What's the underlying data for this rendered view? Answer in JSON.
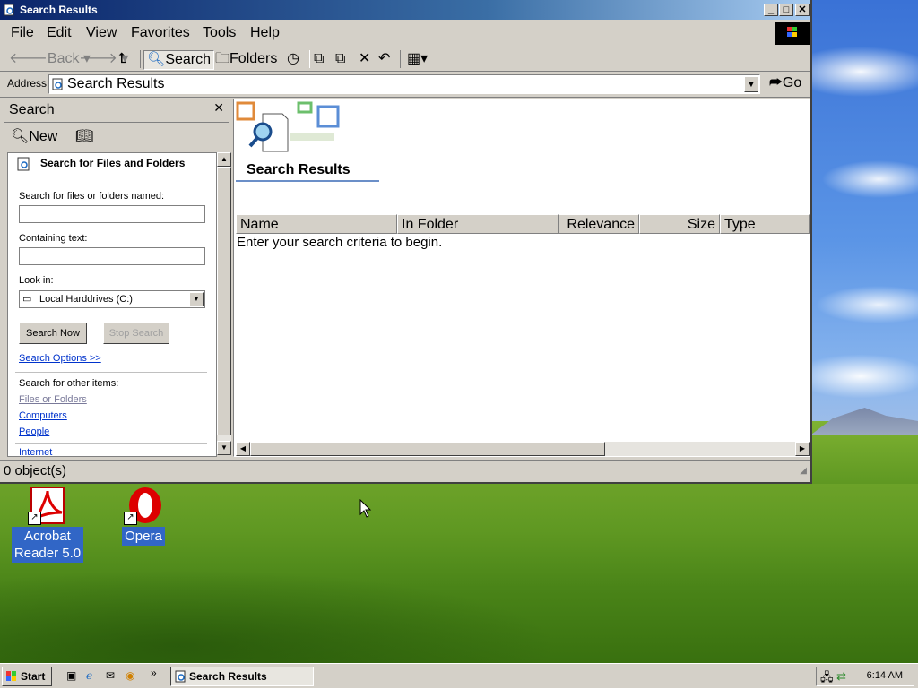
{
  "window": {
    "title": "Search Results",
    "menu": [
      "File",
      "Edit",
      "View",
      "Favorites",
      "Tools",
      "Help"
    ],
    "toolbar": {
      "back": "Back",
      "search": "Search",
      "folders": "Folders"
    },
    "address": {
      "label": "Address",
      "value": "Search Results",
      "go": "Go"
    },
    "status": "0 object(s)"
  },
  "search_pane": {
    "title": "Search",
    "new_label": "New",
    "heading": "Search for Files and Folders",
    "named_label": "Search for files or folders named:",
    "named_value": "",
    "containing_label": "Containing text:",
    "containing_value": "",
    "look_in_label": "Look in:",
    "look_in_value": "Local Harddrives (C:)",
    "search_now": "Search Now",
    "stop_search": "Stop Search",
    "options_link": "Search Options >>",
    "other_items_label": "Search for other items:",
    "other_items": [
      "Files or Folders",
      "Computers",
      "People",
      "Internet"
    ]
  },
  "results": {
    "title": "Search Results",
    "columns": [
      "Name",
      "In Folder",
      "Relevance",
      "Size",
      "Type"
    ],
    "empty_message": "Enter your search criteria to begin."
  },
  "desktop": {
    "icons": [
      {
        "label_line1": "Acrobat",
        "label_line2": "Reader 5.0"
      },
      {
        "label_line1": "Opera",
        "label_line2": ""
      }
    ]
  },
  "taskbar": {
    "start": "Start",
    "task": "Search Results",
    "clock": "6:14 AM"
  },
  "colors": {
    "titlebar_start": "#0a246a",
    "titlebar_end": "#a6caf0",
    "link": "#0033cc",
    "window_bg": "#d4d0c8"
  }
}
